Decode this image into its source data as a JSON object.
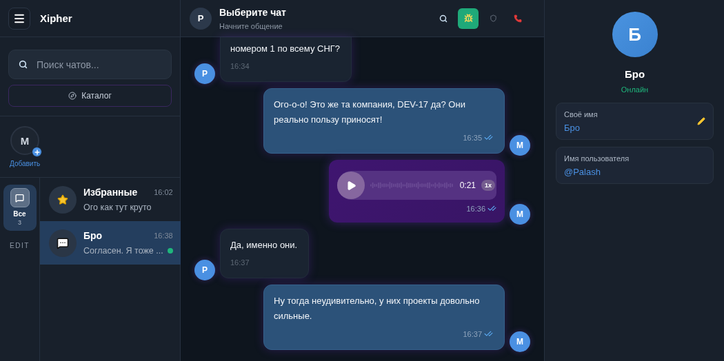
{
  "app": {
    "title": "Xipher"
  },
  "search": {
    "placeholder": "Поиск чатов..."
  },
  "catalog_button": {
    "label": "Каталог"
  },
  "stories": [
    {
      "initial": "M",
      "label": "Добавить"
    }
  ],
  "folders": [
    {
      "label": "Все",
      "count": "3",
      "selected": true
    }
  ],
  "folders_edit": "EDIT",
  "chats": [
    {
      "kind": "favorites",
      "name": "Избранные",
      "time": "16:02",
      "preview": "Ого как тут круто",
      "selected": false,
      "online": false
    },
    {
      "kind": "chat",
      "name": "Бро",
      "time": "16:38",
      "preview": "Согласен. Я тоже ...",
      "selected": true,
      "online": true
    }
  ],
  "chat_header": {
    "initial": "P",
    "title": "Выберите чат",
    "subtitle": "Начните общение"
  },
  "header_actions": [
    {
      "kind": "search",
      "active": false
    },
    {
      "kind": "bug",
      "active": true
    },
    {
      "kind": "shield",
      "active": false
    },
    {
      "kind": "phone",
      "active": false
    }
  ],
  "messages": [
    {
      "kind": "text",
      "outgoing": false,
      "initial": "P",
      "text": "номером 1 по всему СНГ?",
      "time": "16:34"
    },
    {
      "kind": "text",
      "outgoing": true,
      "initial": "M",
      "text": "Ого-о-о! Это же та компания, DEV-17 да? Они реально пользу приносят!",
      "time": "16:35",
      "read": true
    },
    {
      "kind": "voice",
      "outgoing": true,
      "initial": "M",
      "duration": "0:21",
      "speed": "1x",
      "time": "16:36",
      "read": true
    },
    {
      "kind": "text",
      "outgoing": false,
      "initial": "P",
      "text": "Да, именно они.",
      "time": "16:37"
    },
    {
      "kind": "text",
      "outgoing": true,
      "initial": "M",
      "text": "Ну тогда неудивительно, у них проекты довольно сильные.",
      "time": "16:37",
      "read": true
    }
  ],
  "profile": {
    "initial": "Б",
    "name": "Бро",
    "status": "Онлайн"
  },
  "profile_fields": [
    {
      "label": "Своё имя",
      "value": "Бро",
      "editable": true
    },
    {
      "label": "Имя пользователя",
      "value": "@Palash",
      "editable": false
    }
  ]
}
